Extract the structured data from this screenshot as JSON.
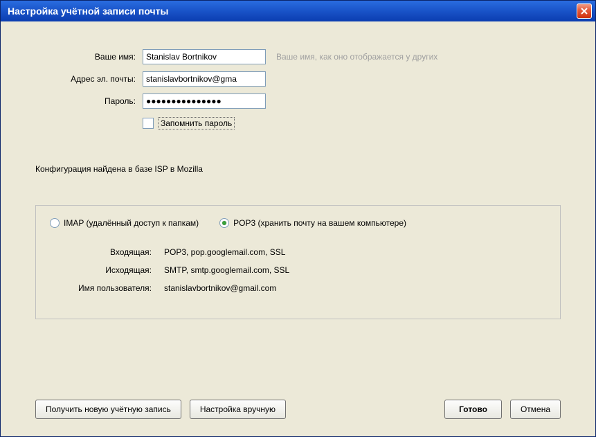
{
  "window": {
    "title": "Настройка учётной записи почты"
  },
  "form": {
    "name_label": "Ваше имя:",
    "name_value": "Stanislav Bortnikov",
    "name_hint": "Ваше имя, как оно отображается у других",
    "email_label": "Адрес эл. почты:",
    "email_value": "stanislavbortnikov@gma",
    "password_label": "Пароль:",
    "password_value": "●●●●●●●●●●●●●●●",
    "remember_label": "Запомнить пароль"
  },
  "status": "Конфигурация найдена в базе ISP в Mozilla",
  "config": {
    "imap_label": "IMAP (удалённый доступ к папкам)",
    "pop3_label": "POP3 (хранить почту на вашем компьютере)",
    "incoming_label": "Входящая:",
    "incoming_value": "POP3, pop.googlemail.com, SSL",
    "outgoing_label": "Исходящая:",
    "outgoing_value": "SMTP, smtp.googlemail.com, SSL",
    "username_label": "Имя пользователя:",
    "username_value": "stanislavbortnikov@gmail.com"
  },
  "buttons": {
    "new_account": "Получить новую учётную запись",
    "manual_config": "Настройка вручную",
    "done": "Готово",
    "cancel": "Отмена"
  }
}
